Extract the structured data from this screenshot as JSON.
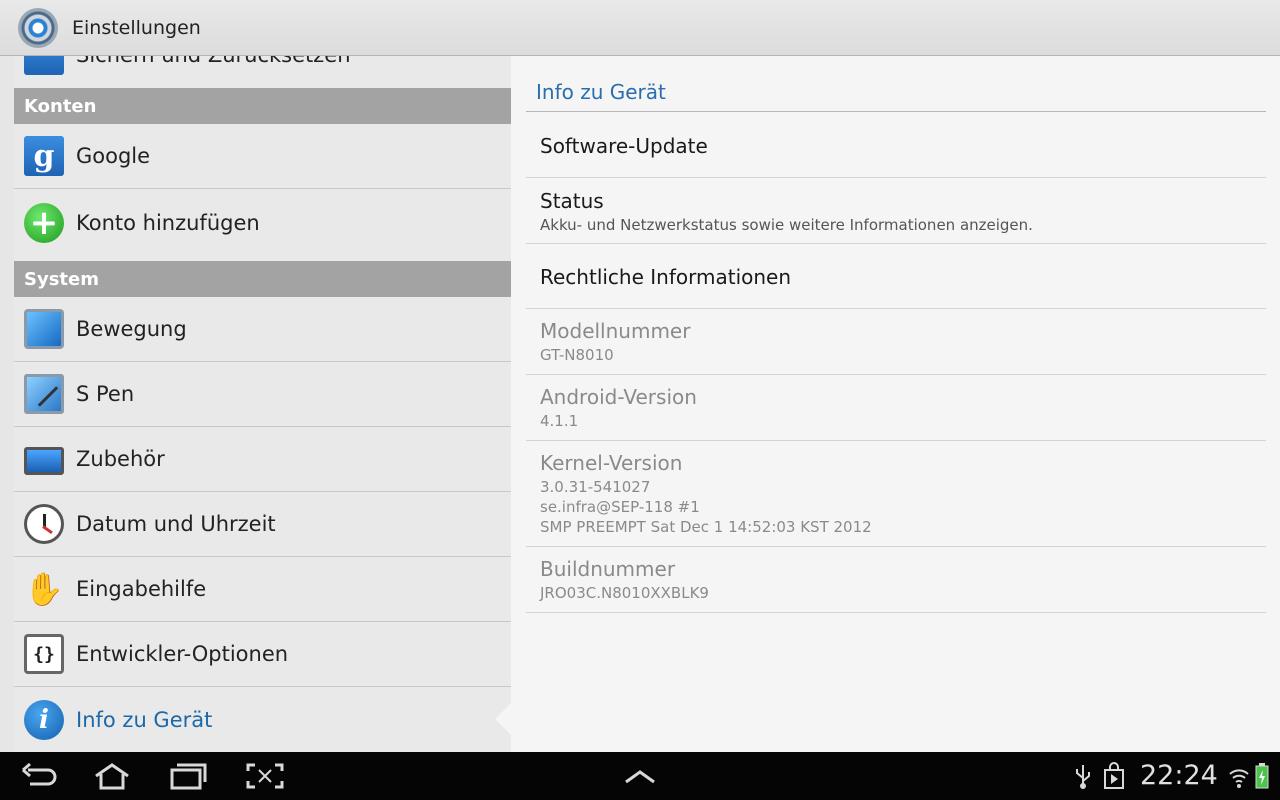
{
  "app": {
    "title": "Einstellungen"
  },
  "left_panel": {
    "partial_item": "Sichern und Zurücksetzen",
    "sections": [
      {
        "header": "Konten",
        "items": [
          {
            "label": "Google",
            "icon": "google-icon"
          },
          {
            "label": "Konto hinzufügen",
            "icon": "add-account-icon"
          }
        ]
      },
      {
        "header": "System",
        "items": [
          {
            "label": "Bewegung",
            "icon": "motion-icon"
          },
          {
            "label": "S Pen",
            "icon": "s-pen-icon"
          },
          {
            "label": "Zubehör",
            "icon": "accessory-icon"
          },
          {
            "label": "Datum und Uhrzeit",
            "icon": "clock-icon"
          },
          {
            "label": "Eingabehilfe",
            "icon": "hand-icon"
          },
          {
            "label": "Entwickler-Optionen",
            "icon": "developer-braces-icon"
          },
          {
            "label": "Info zu Gerät",
            "icon": "info-icon",
            "selected": true
          }
        ]
      }
    ]
  },
  "right_panel": {
    "title": "Info zu Gerät",
    "items": [
      {
        "title": "Software-Update",
        "summary": ""
      },
      {
        "title": "Status",
        "summary": "Akku- und Netzwerkstatus sowie weitere Informationen anzeigen."
      },
      {
        "title": "Rechtliche Informationen",
        "summary": ""
      },
      {
        "title": "Modellnummer",
        "summary": "GT-N8010"
      },
      {
        "title": "Android-Version",
        "summary": "4.1.1"
      },
      {
        "title": "Kernel-Version",
        "summary_lines": [
          "3.0.31-541027",
          "se.infra@SEP-118 #1",
          "SMP PREEMPT Sat Dec 1 14:52:03 KST 2012"
        ]
      },
      {
        "title": "Buildnummer",
        "summary": "JRO03C.N8010XXBLK9"
      }
    ]
  },
  "navbar": {
    "time": "22:24",
    "icons": [
      "back-icon",
      "home-icon",
      "recent-apps-icon",
      "screenshot-icon",
      "up-arrow-icon",
      "usb-icon",
      "play-store-icon",
      "wifi-icon",
      "battery-icon"
    ]
  },
  "colors": {
    "accent": "#2a6eb0",
    "section_header": "#a3a3a3",
    "navbar": "#050505"
  }
}
